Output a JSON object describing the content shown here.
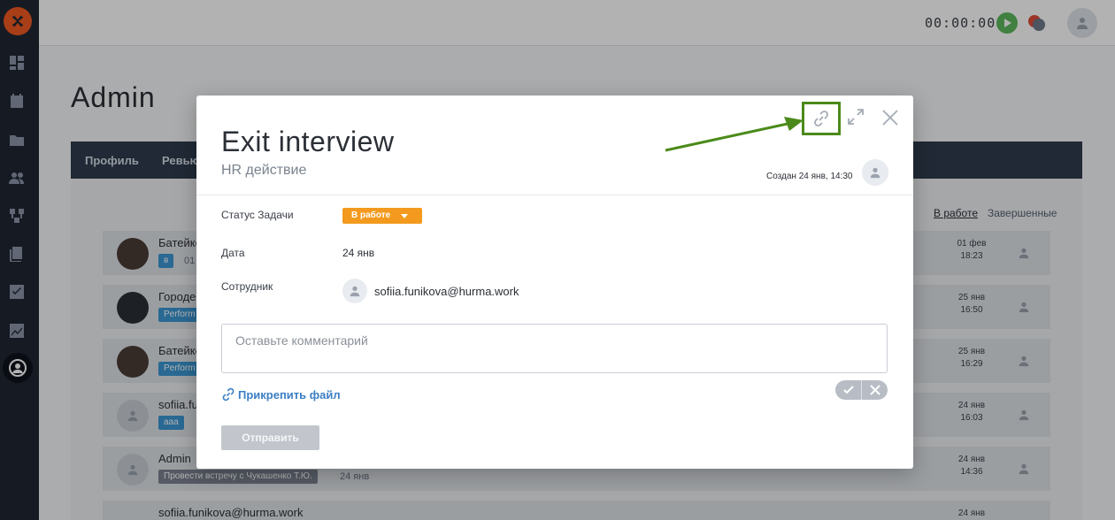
{
  "topbar": {
    "timer": "00:00:00"
  },
  "page": {
    "title": "Admin",
    "tabs": [
      "Профиль",
      "Ревью"
    ],
    "filters": [
      "В работе",
      "Завершенные"
    ]
  },
  "rows": [
    {
      "name": "Батейко",
      "tag": "в",
      "sub": "01",
      "date_line1": "01 фев",
      "date_line2": "18:23"
    },
    {
      "name": "Городе",
      "tag": "Perform",
      "date_line1": "25 янв",
      "date_line2": "16:50"
    },
    {
      "name": "Батейко",
      "tag": "Perform",
      "date_line1": "25 янв",
      "date_line2": "16:29"
    },
    {
      "name": "sofiia.fun",
      "tag": "ааа",
      "date_line1": "24 янв",
      "date_line2": "16:03"
    },
    {
      "name": "Admin",
      "tag": "Провести встречу с Чукашенко Т.Ю.",
      "sub": "24 янв",
      "date_line1": "24 янв",
      "date_line2": "14:36"
    },
    {
      "name": "sofiia.funikova@hurma.work",
      "date_line1": "24 янв"
    }
  ],
  "modal": {
    "title": "Exit interview",
    "subtitle": "HR действие",
    "created": "Создан 24 янв, 14:30",
    "status_label": "Статус Задачи",
    "status_value": "В работе",
    "date_label": "Дата",
    "date_value": "24 янв",
    "employee_label": "Сотрудник",
    "employee_email": "sofiia.funikova@hurma.work",
    "comment_placeholder": "Оставьте комментарий",
    "attach_label": "Прикрепить файл",
    "send_label": "Отправить"
  },
  "colors": {
    "accent_orange": "#f39a1e",
    "highlight_green": "#4b8a1a",
    "link_blue": "#3b7fc4",
    "sidebar": "#1f2633"
  },
  "icons": [
    "logo-icon",
    "dashboard-icon",
    "calendar-icon",
    "folder-user-icon",
    "people-icon",
    "structure-icon",
    "documents-icon",
    "checklist-icon",
    "chart-icon",
    "profile-icon",
    "link-icon",
    "expand-icon",
    "close-icon",
    "paperclip-icon",
    "check-icon",
    "cross-icon",
    "play-icon",
    "chat-icon"
  ]
}
